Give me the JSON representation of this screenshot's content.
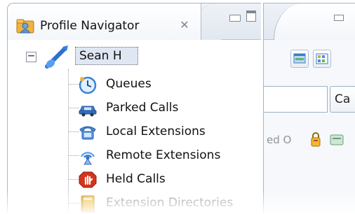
{
  "navigator": {
    "title": "Profile Navigator",
    "tab_icon": "profile-navigator-icon",
    "close_icon": "close-icon",
    "root": {
      "label": "Sean H",
      "icon": "user-guitar-icon",
      "expanded": true
    },
    "items": [
      {
        "label": "Queues",
        "icon": "queues-clock-icon"
      },
      {
        "label": "Parked Calls",
        "icon": "parked-car-icon"
      },
      {
        "label": "Local Extensions",
        "icon": "phone-icon"
      },
      {
        "label": "Remote Extensions",
        "icon": "remote-antenna-icon"
      },
      {
        "label": "Held Calls",
        "icon": "held-hand-icon"
      },
      {
        "label": "Extension Directories",
        "icon": "directory-book-icon"
      }
    ]
  },
  "right_view": {
    "combo_text": "Ca",
    "status_text": "ed O"
  }
}
